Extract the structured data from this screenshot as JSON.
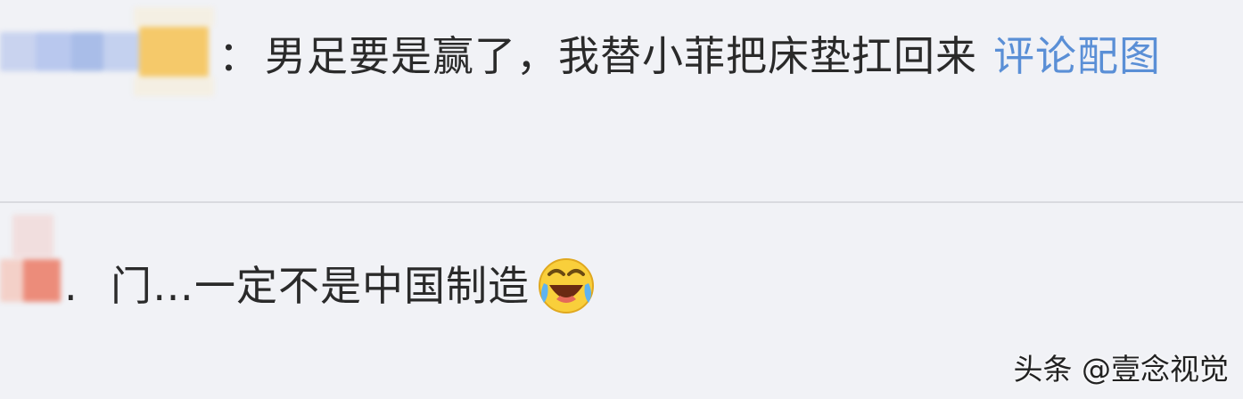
{
  "comments": [
    {
      "separator": "：",
      "text": "男足要是赢了，我替小菲把床垫扛回来",
      "link": "评论配图"
    },
    {
      "separator": ".",
      "text": "门…一定不是中国制造",
      "emoji": "laughing-crying-emoji"
    }
  ],
  "watermark": "头条 @壹念视觉",
  "colors": {
    "background": "#f1f2f6",
    "text": "#2a2a2a",
    "link": "#5a8fd6",
    "divider": "#d9dadf"
  }
}
